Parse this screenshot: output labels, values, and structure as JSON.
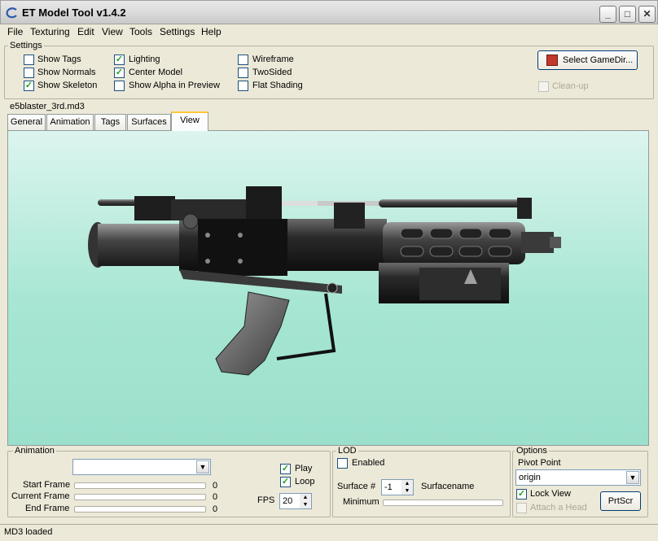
{
  "window": {
    "title": "ET Model Tool v1.4.2",
    "minimize": "_",
    "maximize": "□",
    "close": "✕"
  },
  "menu": [
    "File",
    "Texturing",
    "Edit",
    "View",
    "Tools",
    "Settings",
    "Help"
  ],
  "settings": {
    "legend": "Settings",
    "col1": [
      {
        "label": "Show Tags",
        "checked": false
      },
      {
        "label": "Show Normals",
        "checked": false
      },
      {
        "label": "Show Skeleton",
        "checked": true
      }
    ],
    "col2": [
      {
        "label": "Lighting",
        "checked": true
      },
      {
        "label": "Center Model",
        "checked": true
      },
      {
        "label": "Show Alpha in Preview",
        "checked": false
      }
    ],
    "col3": [
      {
        "label": "Wireframe",
        "checked": false
      },
      {
        "label": "TwoSided",
        "checked": false
      },
      {
        "label": "Flat Shading",
        "checked": false
      }
    ],
    "select_gamedir": "Select GameDir...",
    "cleanup": "Clean-up"
  },
  "file_label": "e5blaster_3rd.md3",
  "tabs": [
    "General",
    "Animation",
    "Tags",
    "Surfaces",
    "View"
  ],
  "active_tab": "View",
  "animation": {
    "legend": "Animation",
    "combo_value": "",
    "start_frame_label": "Start Frame",
    "start_frame_value": "0",
    "current_frame_label": "Current Frame",
    "current_frame_value": "0",
    "end_frame_label": "End Frame",
    "end_frame_value": "0",
    "play_label": "Play",
    "play_checked": true,
    "loop_label": "Loop",
    "loop_checked": true,
    "fps_label": "FPS",
    "fps_value": "20"
  },
  "lod": {
    "legend": "LOD",
    "enabled_label": "Enabled",
    "enabled_checked": false,
    "surface_label": "Surface #",
    "surface_value": "-1",
    "surfacename_label": "Surfacename",
    "minimum_label": "Minimum"
  },
  "options": {
    "legend": "Options",
    "pivot_label": "Pivot Point",
    "pivot_value": "origin",
    "lock_view_label": "Lock View",
    "lock_view_checked": true,
    "attach_head_label": "Attach a Head",
    "prtscr": "PrtScr"
  },
  "status": "MD3 loaded",
  "colors": {
    "accent_tab": "#ffc83c",
    "viewport_top": "#dcf5ee",
    "viewport_bottom": "#9be0cc",
    "check": "#21a121"
  },
  "icons": [
    "app-icon",
    "minimize-icon",
    "maximize-icon",
    "close-icon",
    "gamedir-icon",
    "chevron-down-icon",
    "spin-up-icon",
    "spin-down-icon"
  ]
}
